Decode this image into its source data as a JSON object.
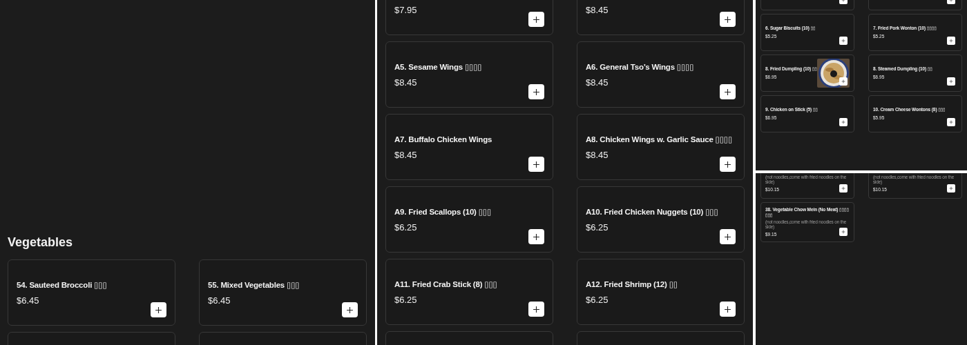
{
  "panels": [
    {
      "heading": "Vegetables",
      "items": [
        {
          "kind": "full",
          "name": "54. Sauteed Broccoli ▯▯▯",
          "price": "$6.45"
        },
        {
          "kind": "full",
          "name": "55. Mixed Vegetables ▯▯▯",
          "price": "$6.45"
        },
        {
          "kind": "cut-bottom"
        },
        {
          "kind": "cut-bottom"
        }
      ]
    },
    {
      "items": [
        {
          "kind": "cut-top",
          "price": "$7.95"
        },
        {
          "kind": "cut-top",
          "price": "$8.45"
        },
        {
          "kind": "full",
          "name": "A5. Sesame Wings ▯▯▯▯",
          "price": "$8.45"
        },
        {
          "kind": "full",
          "name": "A6. General Tso’s Wings ▯▯▯▯",
          "price": "$8.45"
        },
        {
          "kind": "full",
          "name": "A7. Buffalo Chicken Wings",
          "price": "$8.45"
        },
        {
          "kind": "full",
          "name": "A8. Chicken Wings w. Garlic Sauce ▯▯▯▯",
          "price": "$8.45"
        },
        {
          "kind": "full",
          "name": "A9. Fried Scallops (10) ▯▯▯",
          "price": "$6.25"
        },
        {
          "kind": "full",
          "name": "A10. Fried Chicken Nuggets (10) ▯▯▯",
          "price": "$6.25"
        },
        {
          "kind": "full",
          "name": "A11. Fried Crab Stick (8) ▯▯▯",
          "price": "$6.25"
        },
        {
          "kind": "full",
          "name": "A12. Fried Shrimp (12) ▯▯",
          "price": "$6.25"
        },
        {
          "kind": "cut-bottom"
        },
        {
          "kind": "cut-bottom"
        }
      ]
    },
    {
      "items": [
        {
          "kind": "cut-top"
        },
        {
          "kind": "cut-top"
        },
        {
          "kind": "full",
          "name": "6. Sugar Biscuits (10) ▯▯",
          "price": "$5.25"
        },
        {
          "kind": "full",
          "name": "7. Fried Pork Wonton (10) ▯▯▯▯",
          "price": "$5.25"
        },
        {
          "name": "8. Fried Dumpling (10) ▯▯",
          "price": "$6.95"
        },
        {
          "kind": "full",
          "name": "8. Steamed Dumpling (10) ▯▯",
          "price": "$6.95"
        },
        {
          "kind": "full",
          "name": "9. Chicken on Stick (5) ▯▯",
          "price": "$6.95"
        },
        {
          "kind": "full",
          "name": "10. Cream Cheese Wontons (8) ▯▯▯",
          "price": "$5.95"
        }
      ]
    },
    {
      "items": [
        {
          "kind": "cut-top",
          "description": "(not noodles,come with fried noodles on the side)",
          "price": "$10.15"
        },
        {
          "kind": "cut-top",
          "description": "(not noodles,come with fried noodles on the side)",
          "price": "$10.15"
        },
        {
          "kind": "full",
          "name": "38. Vegetable Chow Mein (No Meat) ▯▯▯▯ ▯▯▯",
          "description": "(not noodles,come with fried noodles on the side)",
          "price": "$9.15"
        }
      ]
    }
  ]
}
